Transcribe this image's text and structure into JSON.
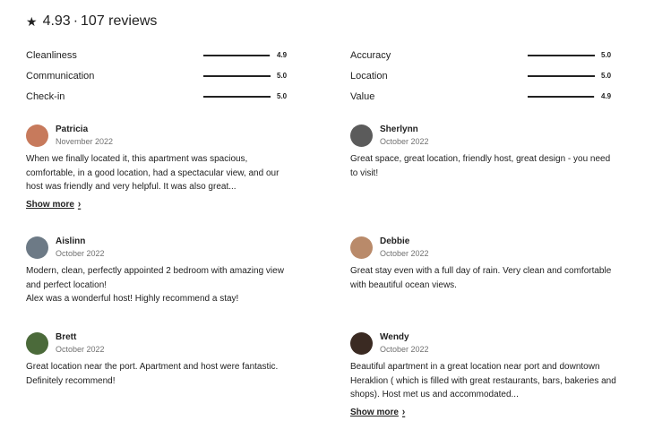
{
  "header": {
    "star_icon": "★",
    "rating": "4.93",
    "separator": "·",
    "reviews": "107 reviews"
  },
  "ratings_left": [
    {
      "label": "Cleanliness",
      "value": "4.9",
      "fill": 0.98
    },
    {
      "label": "Communication",
      "value": "5.0",
      "fill": 1.0
    },
    {
      "label": "Check-in",
      "value": "5.0",
      "fill": 1.0
    }
  ],
  "ratings_right": [
    {
      "label": "Accuracy",
      "value": "5.0",
      "fill": 1.0
    },
    {
      "label": "Location",
      "value": "5.0",
      "fill": 1.0
    },
    {
      "label": "Value",
      "value": "4.9",
      "fill": 0.98
    }
  ],
  "reviews": [
    {
      "name": "Patricia",
      "date": "November 2022",
      "text": "When we finally located it, this apartment was spacious, comfortable, in a good location, had a spectacular view, and our host was friendly and very helpful. It was also great...",
      "show_more": "Show more",
      "avatar_color": "#c77a5c"
    },
    {
      "name": "Sherlynn",
      "date": "October 2022",
      "text": "Great space, great location, friendly host, great design - you need to visit!",
      "show_more": "",
      "avatar_color": "#5b5b5b"
    },
    {
      "name": "Aislinn",
      "date": "October 2022",
      "text": "Modern, clean, perfectly appointed 2 bedroom with amazing view and perfect location!\nAlex was a wonderful host! Highly recommend a stay!",
      "show_more": "",
      "avatar_color": "#6d7a86"
    },
    {
      "name": "Debbie",
      "date": "October 2022",
      "text": "Great stay even with a full day of rain. Very clean and comfortable with beautiful ocean views.",
      "show_more": "",
      "avatar_color": "#b98a6a"
    },
    {
      "name": "Brett",
      "date": "October 2022",
      "text": "Great location near the port. Apartment and host were fantastic. Definitely recommend!",
      "show_more": "",
      "avatar_color": "#4b6a3a"
    },
    {
      "name": "Wendy",
      "date": "October 2022",
      "text": "Beautiful apartment in a great location near port and downtown Heraklion ( which is filled with great restaurants, bars, bakeries and shops). Host met us and accommodated...",
      "show_more": "Show more",
      "avatar_color": "#3a2a22"
    }
  ]
}
